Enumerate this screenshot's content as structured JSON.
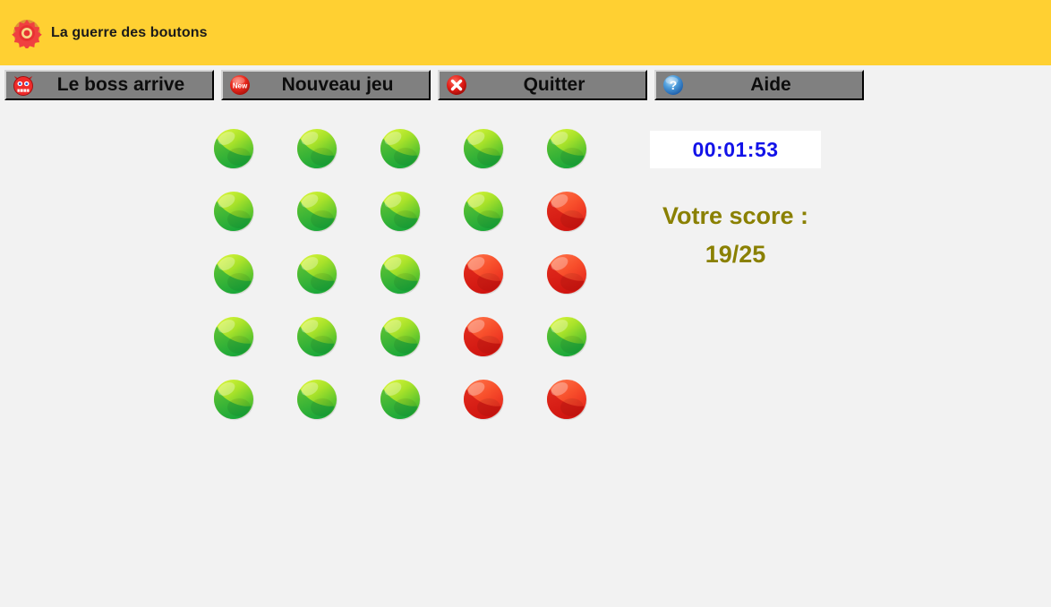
{
  "window": {
    "title": "La guerre des boutons",
    "logo_icon": "target-gear-icon",
    "titlebar_color": "#ffd032",
    "background_color": "#f2f2f2"
  },
  "toolbar": {
    "buttons": [
      {
        "id": "boss",
        "label": "Le boss arrive",
        "icon": "devil-smiley-icon"
      },
      {
        "id": "new",
        "label": "Nouveau jeu",
        "icon": "new-badge-icon"
      },
      {
        "id": "quit",
        "label": "Quitter",
        "icon": "red-x-circle-icon"
      },
      {
        "id": "help",
        "label": "Aide",
        "icon": "blue-question-circle-icon"
      }
    ]
  },
  "game": {
    "rows": 5,
    "cols": 5,
    "green_color": "#3eb027",
    "green_highlight": "#d2f53c",
    "red_color": "#e02020",
    "red_highlight": "#ff6347",
    "states": [
      [
        "green",
        "green",
        "green",
        "green",
        "green"
      ],
      [
        "green",
        "green",
        "green",
        "green",
        "red"
      ],
      [
        "green",
        "green",
        "green",
        "red",
        "red"
      ],
      [
        "green",
        "green",
        "green",
        "red",
        "green"
      ],
      [
        "green",
        "green",
        "green",
        "red",
        "red"
      ]
    ]
  },
  "panel": {
    "timer": "00:01:53",
    "timer_color": "#1212e8",
    "score_label": "Votre score :",
    "score_value": "19/25",
    "score_color": "#8a8000"
  }
}
